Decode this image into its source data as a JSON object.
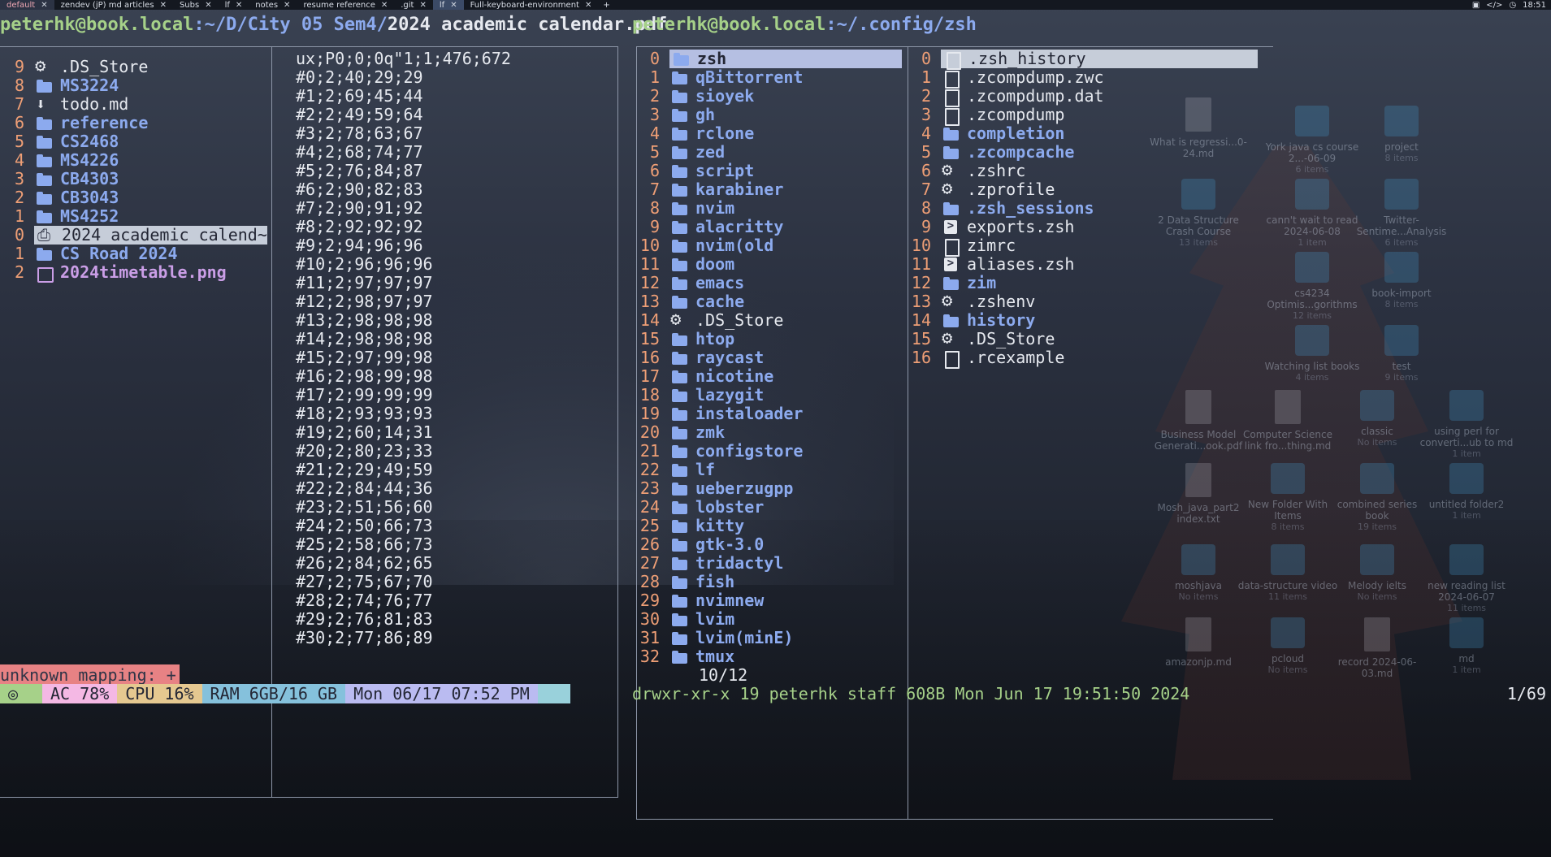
{
  "topbar": {
    "tabs": [
      {
        "label": "default"
      },
      {
        "label": "zendev (jP) md articles"
      },
      {
        "label": "Subs"
      },
      {
        "label": "lf"
      },
      {
        "label": "notes"
      },
      {
        "label": "resume reference"
      },
      {
        "label": ".git"
      },
      {
        "label": "lf"
      },
      {
        "label": "Full-keyboard-environment"
      }
    ],
    "add_label": "+",
    "clock": "18:51"
  },
  "left": {
    "title_user": "peterhk@book.local",
    "title_path": ":~/D/City 05 Sem4/",
    "title_file": "2024 academic calendar.pdf",
    "files": [
      {
        "num": "9",
        "icon": "gear-icon",
        "name": ".DS_Store"
      },
      {
        "num": "8",
        "icon": "folder-icon",
        "name": "MS3224"
      },
      {
        "num": "7",
        "icon": "download-icon",
        "name": "todo.md"
      },
      {
        "num": "6",
        "icon": "folder-icon",
        "name": "reference"
      },
      {
        "num": "5",
        "icon": "folder-icon",
        "name": "CS2468"
      },
      {
        "num": "4",
        "icon": "folder-icon",
        "name": "MS4226"
      },
      {
        "num": "3",
        "icon": "folder-icon",
        "name": "CB4303"
      },
      {
        "num": "2",
        "icon": "folder-icon",
        "name": "CB3043"
      },
      {
        "num": "1",
        "icon": "folder-icon",
        "name": "MS4252"
      },
      {
        "num": "0",
        "icon": "pdf-icon",
        "name": "2024 academic calend~"
      },
      {
        "num": "1",
        "icon": "folder-icon",
        "name": "CS Road 2024"
      },
      {
        "num": "2",
        "icon": "image-icon",
        "name": "2024timetable.png"
      }
    ],
    "preview": [
      "ux;P0;0;0q\"1;1;476;672",
      "#0;2;40;29;29",
      "#1;2;69;45;44",
      "#2;2;49;59;64",
      "#3;2;78;63;67",
      "#4;2;68;74;77",
      "#5;2;76;84;87",
      "#6;2;90;82;83",
      "#7;2;90;91;92",
      "#8;2;92;92;92",
      "#9;2;94;96;96",
      "#10;2;96;96;96",
      "#11;2;97;97;97",
      "#12;2;98;97;97",
      "#13;2;98;98;98",
      "#14;2;98;98;98",
      "#15;2;97;99;98",
      "#16;2;98;99;98",
      "#17;2;99;99;99",
      "#18;2;93;93;93",
      "#19;2;60;14;31",
      "#20;2;80;23;33",
      "#21;2;29;49;59",
      "#22;2;84;44;36",
      "#23;2;51;56;60",
      "#24;2;50;66;73",
      "#25;2;58;66;73",
      "#26;2;84;62;65",
      "#27;2;75;67;70",
      "#28;2;74;76;77",
      "#29;2;76;81;83",
      "#30;2;77;86;89"
    ],
    "message": "unknown mapping: +",
    "counter": "10/12"
  },
  "tmux": {
    "ac": "AC 78%",
    "cpu": "CPU  16%",
    "ram": "RAM 6GB/16 GB",
    "date": "Mon 06/17 07:52 PM"
  },
  "right": {
    "title_user": "peterhk@book.local",
    "title_path": ":~/.config/zsh",
    "dirs": [
      {
        "num": "0",
        "name": "zsh"
      },
      {
        "num": "1",
        "name": "qBittorrent"
      },
      {
        "num": "2",
        "name": "sioyek"
      },
      {
        "num": "3",
        "name": "gh"
      },
      {
        "num": "4",
        "name": "rclone"
      },
      {
        "num": "5",
        "name": "zed"
      },
      {
        "num": "6",
        "name": "script"
      },
      {
        "num": "7",
        "name": "karabiner"
      },
      {
        "num": "8",
        "name": "nvim"
      },
      {
        "num": "9",
        "name": "alacritty"
      },
      {
        "num": "10",
        "name": "nvim(old"
      },
      {
        "num": "11",
        "name": "doom"
      },
      {
        "num": "12",
        "name": "emacs"
      },
      {
        "num": "13",
        "name": "cache"
      },
      {
        "num": "14",
        "name": ".DS_Store",
        "icon": "gear-icon"
      },
      {
        "num": "15",
        "name": "htop"
      },
      {
        "num": "16",
        "name": "raycast"
      },
      {
        "num": "17",
        "name": "nicotine"
      },
      {
        "num": "18",
        "name": "lazygit"
      },
      {
        "num": "19",
        "name": "instaloader"
      },
      {
        "num": "20",
        "name": "zmk"
      },
      {
        "num": "21",
        "name": "configstore"
      },
      {
        "num": "22",
        "name": "lf"
      },
      {
        "num": "23",
        "name": "ueberzugpp"
      },
      {
        "num": "24",
        "name": "lobster"
      },
      {
        "num": "25",
        "name": "kitty"
      },
      {
        "num": "26",
        "name": "gtk-3.0"
      },
      {
        "num": "27",
        "name": "tridactyl"
      },
      {
        "num": "28",
        "name": "fish"
      },
      {
        "num": "29",
        "name": "nvimnew"
      },
      {
        "num": "30",
        "name": "lvim"
      },
      {
        "num": "31",
        "name": "lvim(minE)"
      },
      {
        "num": "32",
        "name": "tmux"
      }
    ],
    "files": [
      {
        "num": "0",
        "icon": "doc-icon",
        "name": ".zsh_history"
      },
      {
        "num": "1",
        "icon": "doc-icon",
        "name": ".zcompdump.zwc"
      },
      {
        "num": "2",
        "icon": "doc-icon",
        "name": ".zcompdump.dat"
      },
      {
        "num": "3",
        "icon": "doc-icon",
        "name": ".zcompdump"
      },
      {
        "num": "4",
        "icon": "folder-icon",
        "name": "completion"
      },
      {
        "num": "5",
        "icon": "folder-icon",
        "name": ".zcompcache"
      },
      {
        "num": "6",
        "icon": "gear-icon",
        "name": ".zshrc"
      },
      {
        "num": "7",
        "icon": "gear-icon",
        "name": ".zprofile"
      },
      {
        "num": "8",
        "icon": "folder-icon",
        "name": ".zsh_sessions"
      },
      {
        "num": "9",
        "icon": "terminal-icon",
        "name": "exports.zsh"
      },
      {
        "num": "10",
        "icon": "doc-icon",
        "name": "zimrc"
      },
      {
        "num": "11",
        "icon": "terminal-icon",
        "name": "aliases.zsh"
      },
      {
        "num": "12",
        "icon": "folder-icon",
        "name": "zim"
      },
      {
        "num": "13",
        "icon": "gear-icon",
        "name": ".zshenv"
      },
      {
        "num": "14",
        "icon": "folder-icon",
        "name": "history"
      },
      {
        "num": "15",
        "icon": "gear-icon",
        "name": ".DS_Store"
      },
      {
        "num": "16",
        "icon": "doc-icon",
        "name": ".rcexample"
      }
    ],
    "status": "drwxr-xr-x 19 peterhk staff 608B Mon Jun 17 19:51:50 2024",
    "counter": "1/69"
  },
  "desktop_icons": [
    {
      "label": "What is regressi...0-24.md",
      "sub": "",
      "kind": "file"
    },
    {
      "label": "York java cs course 2...-06-09",
      "sub": "6 items",
      "kind": "folder"
    },
    {
      "label": "project",
      "sub": "8 items",
      "kind": "folder"
    },
    {
      "label": "2 Data Structure Crash Course",
      "sub": "13 items",
      "kind": "folder"
    },
    {
      "label": "cann't wait to read 2024-06-08",
      "sub": "1 item",
      "kind": "folder"
    },
    {
      "label": "Twitter-Sentime...Analysis",
      "sub": "6 items",
      "kind": "folder"
    },
    {
      "label": "cs4234 Optimis...gorithms",
      "sub": "12 items",
      "kind": "folder"
    },
    {
      "label": "book-import",
      "sub": "8 items",
      "kind": "folder"
    },
    {
      "label": "Watching list books",
      "sub": "4 items",
      "kind": "folder"
    },
    {
      "label": "test",
      "sub": "9 items",
      "kind": "folder"
    },
    {
      "label": "Business Model Generati...ook.pdf",
      "sub": "",
      "kind": "file"
    },
    {
      "label": "Computer Science link fro...thing.md",
      "sub": "",
      "kind": "file"
    },
    {
      "label": "classic",
      "sub": "No items",
      "kind": "folder"
    },
    {
      "label": "using perl for converti...ub to md",
      "sub": "1 item",
      "kind": "folder"
    },
    {
      "label": "Mosh_java_part2 index.txt",
      "sub": "",
      "kind": "file"
    },
    {
      "label": "New Folder With Items",
      "sub": "8 items",
      "kind": "folder"
    },
    {
      "label": "combined series book",
      "sub": "19 items",
      "kind": "folder"
    },
    {
      "label": "untitled folder2",
      "sub": "1 item",
      "kind": "folder"
    },
    {
      "label": "moshjava",
      "sub": "No items",
      "kind": "folder"
    },
    {
      "label": "data-structure video",
      "sub": "11 items",
      "kind": "folder"
    },
    {
      "label": "Melody ielts",
      "sub": "No items",
      "kind": "folder"
    },
    {
      "label": "new reading list 2024-06-07",
      "sub": "11 items",
      "kind": "folder"
    },
    {
      "label": "amazonjp.md",
      "sub": "",
      "kind": "file"
    },
    {
      "label": "pcloud",
      "sub": "No items",
      "kind": "folder"
    },
    {
      "label": "record 2024-06-03.md",
      "sub": "",
      "kind": "file"
    },
    {
      "label": "md",
      "sub": "1 item",
      "kind": "folder"
    }
  ]
}
